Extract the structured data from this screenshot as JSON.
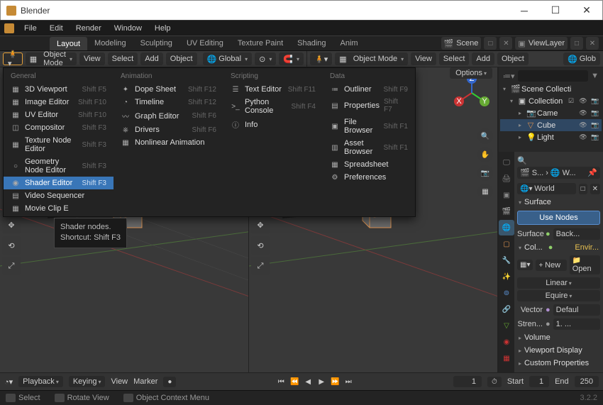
{
  "app": {
    "title": "Blender"
  },
  "menubar": [
    "File",
    "Edit",
    "Render",
    "Window",
    "Help"
  ],
  "workspaces": [
    "Layout",
    "Modeling",
    "Sculpting",
    "UV Editing",
    "Texture Paint",
    "Shading",
    "Anim"
  ],
  "active_workspace": "Layout",
  "scene_label": "Scene",
  "viewlayer_label": "ViewLayer",
  "toolbar": {
    "mode": "Object Mode",
    "view": "View",
    "select": "Select",
    "add": "Add",
    "object": "Object",
    "orient": "Global",
    "mode2": "Object Mode",
    "glob": "Glob"
  },
  "editor_menu": {
    "options": "Options",
    "cols": [
      {
        "header": "General",
        "items": [
          {
            "icon": "▦",
            "label": "3D Viewport",
            "sc": "Shift F5"
          },
          {
            "icon": "▦",
            "label": "Image Editor",
            "sc": "Shift F10"
          },
          {
            "icon": "▦",
            "label": "UV Editor",
            "sc": "Shift F10"
          },
          {
            "icon": "◫",
            "label": "Compositor",
            "sc": "Shift F3"
          },
          {
            "icon": "▦",
            "label": "Texture Node Editor",
            "sc": "Shift F3"
          },
          {
            "icon": "○",
            "label": "Geometry Node Editor",
            "sc": "Shift F3"
          },
          {
            "icon": "◉",
            "label": "Shader Editor",
            "sc": "Shift F3",
            "hover": true
          },
          {
            "icon": "▤",
            "label": "Video Sequencer",
            "sc": ""
          },
          {
            "icon": "▦",
            "label": "Movie Clip E",
            "sc": ""
          }
        ]
      },
      {
        "header": "Animation",
        "items": [
          {
            "icon": "✦",
            "label": "Dope Sheet",
            "sc": "Shift F12"
          },
          {
            "icon": "◔",
            "label": "Timeline",
            "sc": "Shift F12"
          },
          {
            "icon": "〰",
            "label": "Graph Editor",
            "sc": "Shift F6"
          },
          {
            "icon": "⎈",
            "label": "Drivers",
            "sc": "Shift F6"
          },
          {
            "icon": "▦",
            "label": "Nonlinear Animation",
            "sc": ""
          }
        ]
      },
      {
        "header": "Scripting",
        "items": [
          {
            "icon": "☰",
            "label": "Text Editor",
            "sc": "Shift F11"
          },
          {
            "icon": ">_",
            "label": "Python Console",
            "sc": "Shift F4"
          },
          {
            "icon": "ⓘ",
            "label": "Info",
            "sc": ""
          }
        ]
      },
      {
        "header": "Data",
        "items": [
          {
            "icon": "≔",
            "label": "Outliner",
            "sc": "Shift F9"
          },
          {
            "icon": "▤",
            "label": "Properties",
            "sc": "Shift F7"
          },
          {
            "icon": "▣",
            "label": "File Browser",
            "sc": "Shift F1"
          },
          {
            "icon": "▥",
            "label": "Asset Browser",
            "sc": "Shift F1"
          },
          {
            "icon": "▦",
            "label": "Spreadsheet",
            "sc": ""
          },
          {
            "icon": "⚙",
            "label": "Preferences",
            "sc": ""
          }
        ]
      }
    ]
  },
  "tooltip": {
    "line1": "Shader nodes.",
    "line2": "Shortcut: Shift F3"
  },
  "outliner": {
    "root": "Scene Collecti",
    "coll": "Collection",
    "items": [
      {
        "icon": "📷",
        "label": "Came",
        "orange": true
      },
      {
        "icon": "▽",
        "label": "Cube",
        "orange": true,
        "sel": true
      },
      {
        "icon": "💡",
        "label": "Light",
        "orange": true
      }
    ]
  },
  "props": {
    "breadcrumb1": "S...",
    "breadcrumb2": "W...",
    "world": "World",
    "surface_hdr": "Surface",
    "use_nodes": "Use Nodes",
    "surface_lbl": "Surface",
    "surface_val": "Back...",
    "col_lbl": "Col...",
    "col_val": "Envir...",
    "new": "New",
    "open": "Open",
    "linear": "Linear",
    "equire": "Equire",
    "vector_lbl": "Vector",
    "vector_val": "Defaul",
    "stren_lbl": "Stren...",
    "stren_val": "1. ...",
    "volume": "Volume",
    "viewport": "Viewport Display",
    "custom": "Custom Properties"
  },
  "timeline": {
    "playback": "Playback",
    "keying": "Keying",
    "view": "View",
    "marker": "Marker",
    "current": "1",
    "start_lbl": "Start",
    "start": "1",
    "end_lbl": "End",
    "end": "250"
  },
  "status": {
    "select": "Select",
    "rotate": "Rotate View",
    "context": "Object Context Menu",
    "version": "3.2.2"
  }
}
